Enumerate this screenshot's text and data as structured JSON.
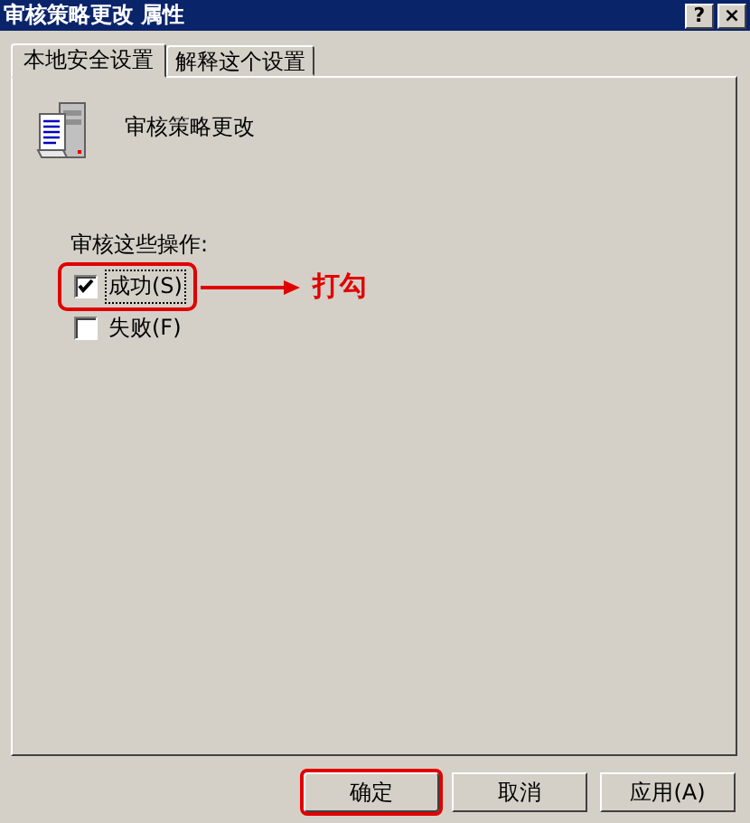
{
  "window": {
    "title": "审核策略更改 属性",
    "title_buttons": [
      "?",
      "×"
    ]
  },
  "tabs": [
    {
      "label": "本地安全设置",
      "selected": true
    },
    {
      "label": "解释这个设置",
      "selected": false
    }
  ],
  "policy": {
    "name": "审核策略更改"
  },
  "audit": {
    "label": "审核这些操作:",
    "options": [
      {
        "label": "成功(S)",
        "checked": true,
        "focused": true,
        "highlighted": true
      },
      {
        "label": "失败(F)",
        "checked": false,
        "focused": false,
        "highlighted": false
      }
    ]
  },
  "annotation": {
    "label": "打勾"
  },
  "buttons": [
    {
      "label": "确定",
      "highlighted": true
    },
    {
      "label": "取消",
      "highlighted": false
    },
    {
      "label": "应用(A)",
      "highlighted": false
    }
  ]
}
